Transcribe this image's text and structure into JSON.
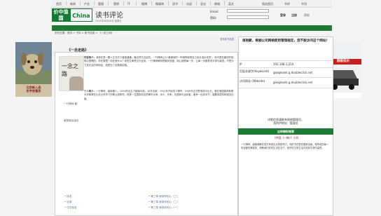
{
  "topnav": {
    "items": [
      "首页",
      "新闻",
      "产业",
      "管理",
      "营销",
      "IT",
      "微博",
      "微媒体",
      "读书",
      "访谈",
      "会议",
      "商城",
      "英文"
    ],
    "links_right": [
      "网站首页",
      "书评",
      "书刊"
    ]
  },
  "logo": {
    "cn": "价中值国",
    "en": "China Value"
  },
  "site": {
    "section": "读书评论",
    "date": "2013年06月20日 星期五"
  },
  "login": {
    "email_label": "Email:",
    "password_label": "密码:",
    "login_button": "登录",
    "register_button": "注册",
    "help_link": "帮助"
  },
  "breadcrumb": "您在位置：首页 > 书评 > 新书品鉴 > 《一念之间》",
  "content": {
    "more_links": "更多新书品鉴",
    "book_title": "《一念走路》",
    "cover_title": "一念之路",
    "author_short": "一行禅师 著",
    "ebook_link": "紫禁城出版社",
    "intro_heading": "内容简介：",
    "intro_text": "我现在是一颗人生流平凡普普通通，最自然又自由的。一行禅师认为\"最美味的一杯咖啡就是自己亲手泡出来的\"，而不是在最好的咖啡店里喝的。你在哪里？你在做什么？你的生命是当下此刻。一行禅师教你把脚步放慢，用心感受每一步，让每一步都带来平静与喜悦。不是为了到达目的地而走，而是为了走路而走路。",
    "author_heading": "个人简介：",
    "author_text": "一行禅师，越南僧人，1926年出生于越南中部，16岁出家，1942年开始学习禅宗，1949年正式受戒成为比丘。曾在美国普林斯顿大学和哥伦比亚大学学习宗教比较研究。他是一名国际知名的禅宗大师、诗人、作家，也是和平运动者，著有一百多本书，被翻译成多种语言出版。"
  },
  "toc_left": [
    "• 序言",
    "• 目录",
    "• 中文前言"
  ],
  "toc_right": [
    "• 第三章  我到你的心（三）",
    "• 第三章  我到你的心（二）",
    "• 第三章  我到你的心（一）"
  ],
  "panel": {
    "blocked_title": "很抱歉，根据公司网络使用管理规定，您不能访问这个网站！",
    "rows": [
      {
        "k": "IP",
        "v": "192.168.1.210"
      },
      {
        "k": "匹配关键字(Keywords)",
        "v": "googleads.g.doubleclick.net"
      },
      {
        "k": "访问网站 (Website)",
        "v": "googleads.g.doubleclick.net"
      }
    ],
    "mgmt_note": "详细信息请联系网络管理员。\n您的IP地址：管理员",
    "comment_head": "这样精彩推荐",
    "comment_title": "《中国（一禅）》十四",
    "comment_body": "一行禅师，越南佛教在西方有着巨大的影响力。他的书在很多国家出版，他所说的每一句话都充满智慧，他教我们如何生活在当下，如何在日常生活中找到平静与喜悦。"
  },
  "ads": {
    "left_text": "北京新人选\n东宇舍管员",
    "right_text": "超级低价"
  }
}
